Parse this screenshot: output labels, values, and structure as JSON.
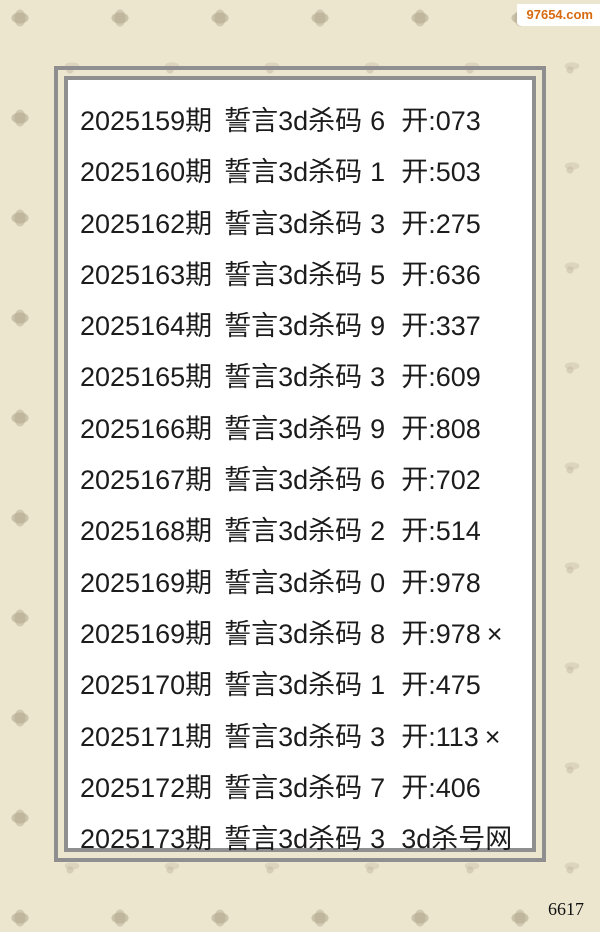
{
  "watermark": "97654.com",
  "page_number": "6617",
  "records": [
    {
      "period": "2025159期",
      "label": "誓言3d杀码",
      "code": "6",
      "result": "开:073",
      "mark": ""
    },
    {
      "period": "2025160期",
      "label": "誓言3d杀码",
      "code": "1",
      "result": "开:503",
      "mark": ""
    },
    {
      "period": "2025162期",
      "label": "誓言3d杀码",
      "code": "3",
      "result": "开:275",
      "mark": ""
    },
    {
      "period": "2025163期",
      "label": "誓言3d杀码",
      "code": "5",
      "result": "开:636",
      "mark": ""
    },
    {
      "period": "2025164期",
      "label": "誓言3d杀码",
      "code": "9",
      "result": "开:337",
      "mark": ""
    },
    {
      "period": "2025165期",
      "label": "誓言3d杀码",
      "code": "3",
      "result": "开:609",
      "mark": ""
    },
    {
      "period": "2025166期",
      "label": "誓言3d杀码",
      "code": "9",
      "result": "开:808",
      "mark": ""
    },
    {
      "period": "2025167期",
      "label": "誓言3d杀码",
      "code": "6",
      "result": "开:702",
      "mark": ""
    },
    {
      "period": "2025168期",
      "label": "誓言3d杀码",
      "code": "2",
      "result": "开:514",
      "mark": ""
    },
    {
      "period": "2025169期",
      "label": "誓言3d杀码",
      "code": "0",
      "result": "开:978",
      "mark": ""
    },
    {
      "period": "2025169期",
      "label": "誓言3d杀码",
      "code": "8",
      "result": "开:978",
      "mark": "×"
    },
    {
      "period": "2025170期",
      "label": "誓言3d杀码",
      "code": "1",
      "result": "开:475",
      "mark": ""
    },
    {
      "period": "2025171期",
      "label": "誓言3d杀码",
      "code": "3",
      "result": "开:113",
      "mark": "×"
    },
    {
      "period": "2025172期",
      "label": "誓言3d杀码",
      "code": "7",
      "result": "开:406",
      "mark": ""
    },
    {
      "period": "2025173期",
      "label": "誓言3d杀码",
      "code": "3",
      "result": "3d杀号网",
      "mark": ""
    }
  ]
}
